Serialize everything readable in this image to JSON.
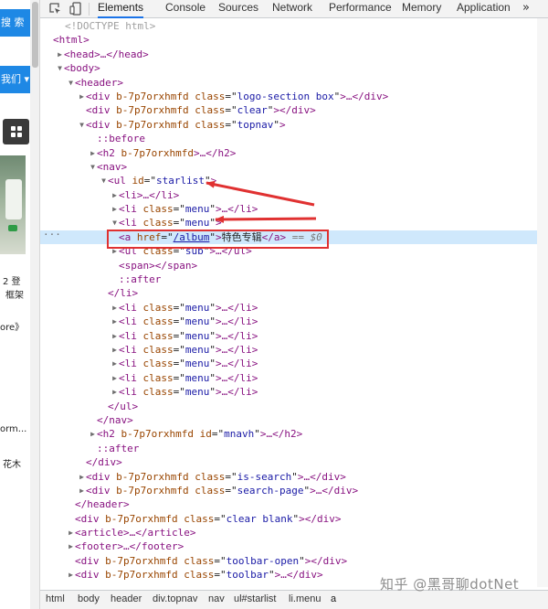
{
  "left_panel": {
    "search_label": "搜 索",
    "about_label": "我们 ▾",
    "texts": [
      "2 登",
      "框架",
      "ore》",
      "orm...",
      "花木"
    ]
  },
  "devtools": {
    "tabs": [
      "Elements",
      "Console",
      "Sources",
      "Network",
      "Performance",
      "Memory",
      "Application"
    ],
    "active_tab": "Elements",
    "more_tabs": "»"
  },
  "dom": {
    "doctype": "<!DOCTYPE html>",
    "attr": "b-7p7orxhmfd",
    "nodes": {
      "html": "html",
      "head": "head",
      "body": "body",
      "header": "header",
      "div": "div",
      "class": "class",
      "id": "id",
      "logo_section": "logo-section box",
      "clear": "clear",
      "topnav": "topnav",
      "before": "::before",
      "after": "::after",
      "h2": "h2",
      "nav": "nav",
      "ul": "ul",
      "starlist": "starlist",
      "li": "li",
      "menu": "menu",
      "a": "a",
      "href_attr": "href",
      "album_href": "/album",
      "album_text": "特色专辑",
      "sub": "sub",
      "span": "span",
      "mnavh": "mnavh",
      "is_search": "is-search",
      "search_page": "search-page",
      "clear_blank": "clear blank",
      "article": "article",
      "footer": "footer",
      "toolbar_open": "toolbar-open",
      "toolbar": "toolbar",
      "eq_sel": "== $0",
      "ellipsis": "…",
      "dots": "···"
    }
  },
  "breadcrumb": [
    "html",
    "body",
    "header",
    "div.topnav",
    "nav",
    "ul#starlist",
    "li.menu",
    "a"
  ],
  "watermark": "知乎 @黑哥聊dotNet",
  "colors": {
    "tag": "#881280",
    "attr_name": "#994500",
    "attr_value": "#1a1aa6",
    "selection": "#cfe8fc",
    "annotation_red": "#e03131",
    "accent_blue": "#1a73e8"
  }
}
